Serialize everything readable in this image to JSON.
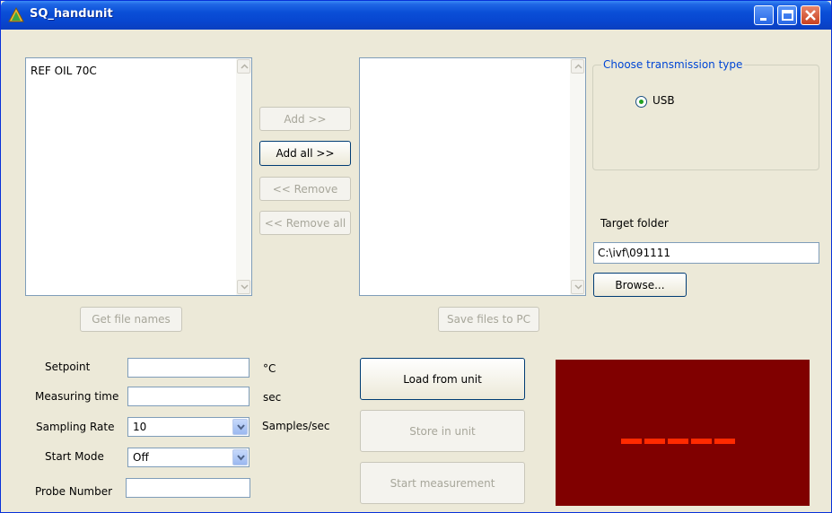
{
  "window": {
    "title": "SQ_handunit",
    "icon": "triangle-app-icon",
    "controls": [
      "minimize-icon",
      "maximize-icon",
      "close-icon"
    ]
  },
  "left_list": {
    "items": [
      "REF OIL 70C"
    ]
  },
  "transfer_buttons": {
    "add": "Add >>",
    "add_all": "Add all >>",
    "remove": "<< Remove",
    "remove_all": "<< Remove all"
  },
  "right_list": {
    "items": []
  },
  "get_file_names": "Get file names",
  "save_files": "Save files to PC",
  "transmission": {
    "legend": "Choose transmission type",
    "option": "USB",
    "selected": true
  },
  "target": {
    "label": "Target folder",
    "value": "C:\\ivf\\091111",
    "browse": "Browse..."
  },
  "settings": {
    "setpoint_label": "Setpoint",
    "setpoint_value": "",
    "setpoint_unit": "°C",
    "measuring_label": "Measuring time",
    "measuring_value": "",
    "measuring_unit": "sec",
    "sampling_label": "Sampling Rate",
    "sampling_value": "10",
    "sampling_unit": "Samples/sec",
    "start_mode_label": "Start Mode",
    "start_mode_value": "Off",
    "probe_label": "Probe Number",
    "probe_value": ""
  },
  "actions": {
    "load": "Load from unit",
    "store": "Store in unit",
    "start": "Start measurement"
  },
  "display": {
    "text": "-----",
    "background": "#800000",
    "segment_color": "#ff2a00"
  }
}
